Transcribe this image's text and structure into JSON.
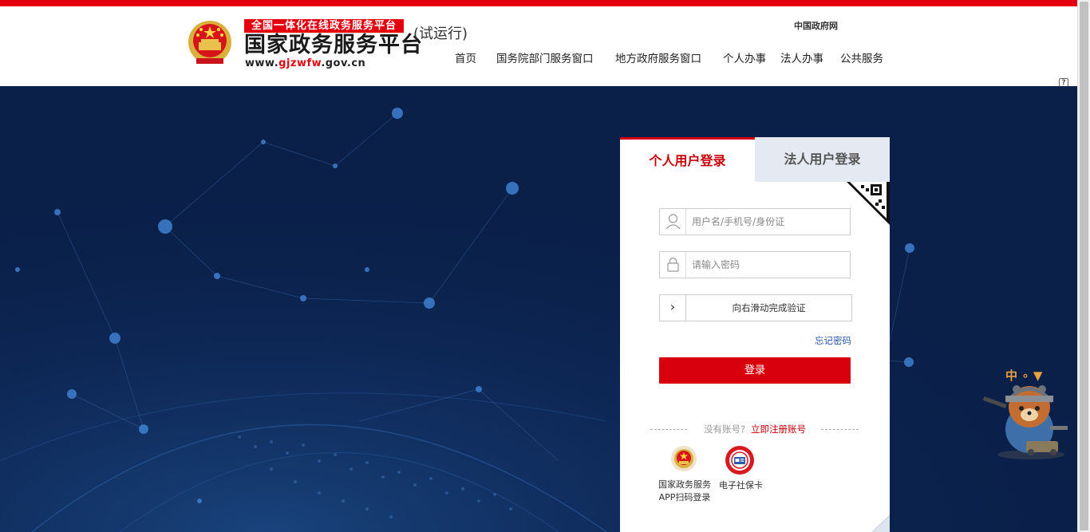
{
  "header": {
    "logo_tag": "全国一体化在线政务服务平台",
    "logo_main": "国家政务服务平台",
    "logo_url_prefix": "www.",
    "logo_url_highlight": "gjzwfw",
    "logo_url_suffix": ".gov.cn",
    "trial": "(试运行)",
    "gov_link": "中国政府网",
    "nav": [
      "首页",
      "国务院部门服务窗口",
      "地方政府服务窗口",
      "个人办事",
      "法人办事",
      "公共服务"
    ],
    "help_icon": "question-mark-icon"
  },
  "login": {
    "tab_personal": "个人用户登录",
    "tab_corp": "法人用户登录",
    "username_placeholder": "用户名/手机号/身份证",
    "password_placeholder": "请输入密码",
    "slider_text": "向右滑动完成验证",
    "slider_handle": "›",
    "forgot": "忘记密码",
    "login_button": "登录",
    "no_account": "没有账号?",
    "register": "立即注册账号",
    "app_label": "国家政务服务APP扫码登录",
    "social_label": "电子社保卡"
  },
  "mascot": {
    "badge_text": "中 ∘ ▼"
  },
  "colors": {
    "brand_red": "#e4000f",
    "banner_bg": "#0a2049",
    "link_blue": "#2a5aa8",
    "tab_inactive_bg": "#e4e9f2"
  },
  "icons": [
    "national-emblem-icon",
    "user-icon",
    "lock-icon",
    "qr-code-icon",
    "chevron-right-icon",
    "app-emblem-icon",
    "social-security-card-icon"
  ]
}
